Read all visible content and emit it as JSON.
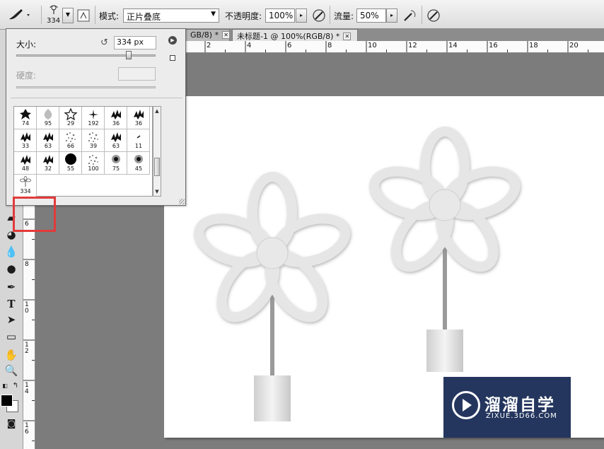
{
  "options_bar": {
    "brush_size": "334",
    "mode_label": "模式:",
    "mode_value": "正片叠底",
    "opacity_label": "不透明度:",
    "opacity_value": "100%",
    "flow_label": "流量:",
    "flow_value": "50%"
  },
  "tabs": [
    {
      "label": "GB/8) *",
      "active": false
    },
    {
      "label": "未标题-1 @ 100%(RGB/8) *",
      "active": true
    }
  ],
  "ruler_h": [
    "2",
    "4",
    "6",
    "8",
    "10",
    "12",
    "14",
    "16",
    "18",
    "20"
  ],
  "ruler_v": [
    "6",
    "8",
    "10",
    "12",
    "14",
    "16"
  ],
  "brush_picker": {
    "size_label": "大小:",
    "size_value": "334 px",
    "hardness_label": "硬度:",
    "brushes": [
      {
        "size": "74",
        "shape": "leaf"
      },
      {
        "size": "95",
        "shape": "soft-blob"
      },
      {
        "size": "29",
        "shape": "star"
      },
      {
        "size": "192",
        "shape": "sparkle"
      },
      {
        "size": "36",
        "shape": "foliage"
      },
      {
        "size": "36",
        "shape": "foliage"
      },
      {
        "size": "33",
        "shape": "foliage"
      },
      {
        "size": "63",
        "shape": "foliage"
      },
      {
        "size": "66",
        "shape": "scatter"
      },
      {
        "size": "39",
        "shape": "scatter"
      },
      {
        "size": "63",
        "shape": "foliage"
      },
      {
        "size": "11",
        "shape": "dash"
      },
      {
        "size": "48",
        "shape": "foliage"
      },
      {
        "size": "32",
        "shape": "foliage"
      },
      {
        "size": "55",
        "shape": "hard-round"
      },
      {
        "size": "100",
        "shape": "scatter"
      },
      {
        "size": "75",
        "shape": "soft-round"
      },
      {
        "size": "45",
        "shape": "soft-round"
      },
      {
        "size": "334",
        "shape": "flower"
      }
    ]
  },
  "watermark": {
    "brand": "溜溜自学",
    "url": "ZIXUE.3D66.COM",
    "bg_color": "#24365e"
  }
}
